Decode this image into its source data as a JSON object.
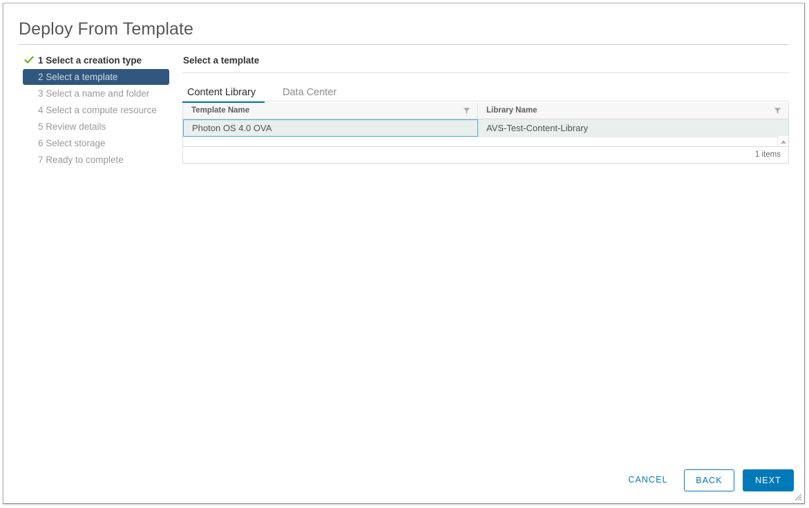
{
  "dialog": {
    "title": "Deploy From Template"
  },
  "steps": {
    "items": [
      {
        "label": "1 Select a creation type",
        "state": "done"
      },
      {
        "label": "2 Select a template",
        "state": "active"
      },
      {
        "label": "3 Select a name and folder",
        "state": "pending"
      },
      {
        "label": "4 Select a compute resource",
        "state": "pending"
      },
      {
        "label": "5 Review details",
        "state": "pending"
      },
      {
        "label": "6 Select storage",
        "state": "pending"
      },
      {
        "label": "7 Ready to complete",
        "state": "pending"
      }
    ],
    "check_icon": "check-icon",
    "check_color": "#60b515"
  },
  "pane": {
    "heading": "Select a template",
    "tabs": [
      {
        "label": "Content Library",
        "selected": true
      },
      {
        "label": "Data Center",
        "selected": false
      }
    ],
    "active_tab_color": "#0079b8"
  },
  "grid": {
    "columns": [
      {
        "header": "Template Name",
        "filter_icon": "filter-icon"
      },
      {
        "header": "Library Name",
        "filter_icon": "filter-icon"
      }
    ],
    "rows": [
      {
        "template_name": "Photon OS 4.0 OVA",
        "library_name": "AVS-Test-Content-Library",
        "selected": true
      }
    ],
    "selection_border_color": "#49afd9",
    "selection_fill_color": "#e9efed",
    "footer_count": "1 items",
    "scroll_up_icon": "scroll-up-arrow-icon",
    "scroll_down_icon": "scroll-down-arrow-icon"
  },
  "footer": {
    "cancel_label": "CANCEL",
    "back_label": "BACK",
    "next_label": "NEXT",
    "accent_color": "#0079b8"
  },
  "window": {
    "resize_grip_icon": "resize-grip-icon"
  }
}
